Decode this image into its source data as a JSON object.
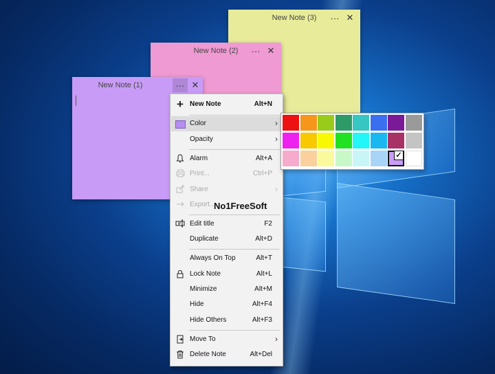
{
  "notes": [
    {
      "title": "New Note (3)",
      "color": "#e8ec9a",
      "more": "···",
      "close": "✕"
    },
    {
      "title": "New Note (2)",
      "color": "#ef9ad2",
      "more": "···",
      "close": "✕"
    },
    {
      "title": "New Note (1)",
      "color": "#c89cf6",
      "more": "···",
      "close": "✕"
    }
  ],
  "menu": {
    "new_note": {
      "label": "New Note",
      "shortcut": "Alt+N",
      "icon": "plus-icon"
    },
    "color": {
      "label": "Color",
      "icon": "color-swatch-icon"
    },
    "opacity": {
      "label": "Opacity"
    },
    "alarm": {
      "label": "Alarm",
      "shortcut": "Alt+A",
      "icon": "bell-icon"
    },
    "print": {
      "label": "Print...",
      "shortcut": "Ctrl+P",
      "icon": "printer-icon"
    },
    "share": {
      "label": "Share",
      "icon": "share-icon"
    },
    "export": {
      "label": "Export...",
      "icon": "export-icon"
    },
    "edit_title": {
      "label": "Edit title",
      "shortcut": "F2",
      "icon": "rename-icon"
    },
    "duplicate": {
      "label": "Duplicate",
      "shortcut": "Alt+D"
    },
    "always_on_top": {
      "label": "Always On Top",
      "shortcut": "Alt+T"
    },
    "lock_note": {
      "label": "Lock Note",
      "shortcut": "Alt+L",
      "icon": "lock-icon"
    },
    "minimize": {
      "label": "Minimize",
      "shortcut": "Alt+M"
    },
    "hide": {
      "label": "Hide",
      "shortcut": "Alt+F4"
    },
    "hide_others": {
      "label": "Hide Others",
      "shortcut": "Alt+F3"
    },
    "move_to": {
      "label": "Move To",
      "icon": "move-to-icon"
    },
    "delete_note": {
      "label": "Delete Note",
      "shortcut": "Alt+Del",
      "icon": "trash-icon"
    }
  },
  "palette": {
    "rows": [
      [
        "#ee1111",
        "#f6961a",
        "#99cc1a",
        "#2e9a68",
        "#38c6c2",
        "#3a6ff0",
        "#7a1a96",
        "#9a9a9a"
      ],
      [
        "#ee22ee",
        "#f8c800",
        "#f8f800",
        "#22e022",
        "#22f6f6",
        "#1ab8f0",
        "#a83266",
        "#c4c4c4"
      ],
      [
        "#f6aacc",
        "#fad09c",
        "#fafa9c",
        "#c8f8c8",
        "#c8f6f6",
        "#a8d4f8",
        "#c89cf6",
        "#ffffff"
      ]
    ],
    "selected": {
      "row": 2,
      "col": 6
    },
    "check": "✓"
  },
  "watermark": "No1FreeSoft"
}
